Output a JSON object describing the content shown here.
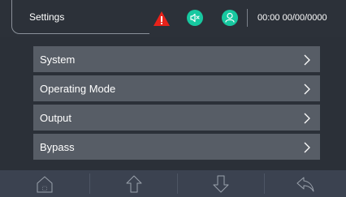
{
  "header": {
    "title": "Settings",
    "datetime": "00:00 00/00/0000",
    "icons": [
      "warning-icon",
      "mute-icon",
      "user-icon"
    ],
    "colors": {
      "warning": "#e8221a",
      "status": "#17c8a0"
    }
  },
  "menu": {
    "items": [
      {
        "label": "System"
      },
      {
        "label": "Operating Mode"
      },
      {
        "label": "Output"
      },
      {
        "label": "Bypass"
      }
    ]
  },
  "footer": {
    "buttons": [
      "home-icon",
      "up-arrow-icon",
      "down-arrow-icon",
      "back-icon"
    ]
  }
}
